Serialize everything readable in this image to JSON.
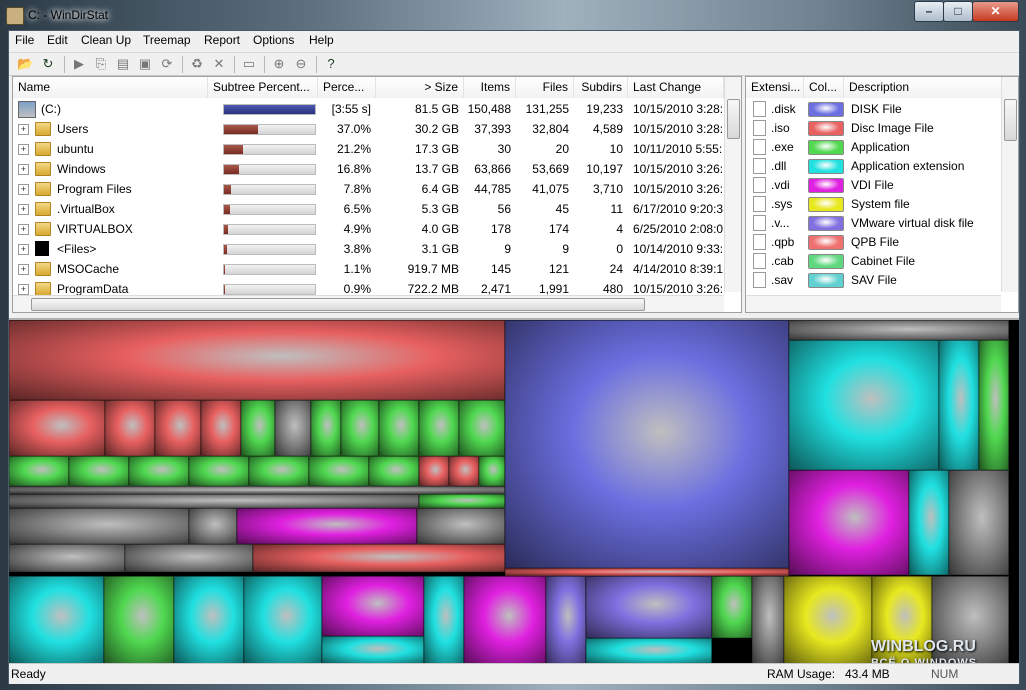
{
  "window": {
    "title": "C: - WinDirStat"
  },
  "menu": [
    "File",
    "Edit",
    "Clean Up",
    "Treemap",
    "Report",
    "Options",
    "Help"
  ],
  "tree": {
    "columns": [
      "Name",
      "Subtree Percent...",
      "Perce...",
      "> Size",
      "Items",
      "Files",
      "Subdirs",
      "Last Change"
    ],
    "rows": [
      {
        "name": "(C:)",
        "bar": 1.0,
        "percent": "[3:55 s]",
        "size": "81.5 GB",
        "items": "150,488",
        "files": "131,255",
        "subdirs": "19,233",
        "last_change": "10/15/2010  3:28:"
      },
      {
        "name": "Users",
        "bar": 0.37,
        "percent": "37.0%",
        "size": "30.2 GB",
        "items": "37,393",
        "files": "32,804",
        "subdirs": "4,589",
        "last_change": "10/15/2010  3:28:"
      },
      {
        "name": "ubuntu",
        "bar": 0.212,
        "percent": "21.2%",
        "size": "17.3 GB",
        "items": "30",
        "files": "20",
        "subdirs": "10",
        "last_change": "10/11/2010  5:55:"
      },
      {
        "name": "Windows",
        "bar": 0.168,
        "percent": "16.8%",
        "size": "13.7 GB",
        "items": "63,866",
        "files": "53,669",
        "subdirs": "10,197",
        "last_change": "10/15/2010  3:26:"
      },
      {
        "name": "Program Files",
        "bar": 0.078,
        "percent": "7.8%",
        "size": "6.4 GB",
        "items": "44,785",
        "files": "41,075",
        "subdirs": "3,710",
        "last_change": "10/15/2010  3:26:"
      },
      {
        "name": ".VirtualBox",
        "bar": 0.065,
        "percent": "6.5%",
        "size": "5.3 GB",
        "items": "56",
        "files": "45",
        "subdirs": "11",
        "last_change": "6/17/2010  9:20:3"
      },
      {
        "name": "VIRTUALBOX",
        "bar": 0.049,
        "percent": "4.9%",
        "size": "4.0 GB",
        "items": "178",
        "files": "174",
        "subdirs": "4",
        "last_change": "6/25/2010  2:08:0"
      },
      {
        "name": "<Files>",
        "bar": 0.038,
        "percent": "3.8%",
        "size": "3.1 GB",
        "items": "9",
        "files": "9",
        "subdirs": "0",
        "last_change": "10/14/2010  9:33:"
      },
      {
        "name": "MSOCache",
        "bar": 0.011,
        "percent": "1.1%",
        "size": "919.7 MB",
        "items": "145",
        "files": "121",
        "subdirs": "24",
        "last_change": "4/14/2010  8:39:1"
      },
      {
        "name": "ProgramData",
        "bar": 0.009,
        "percent": "0.9%",
        "size": "722.2 MB",
        "items": "2,471",
        "files": "1,991",
        "subdirs": "480",
        "last_change": "10/15/2010  3:26:"
      }
    ]
  },
  "extensions": {
    "columns": [
      "Extensi...",
      "Col...",
      "Description"
    ],
    "rows": [
      {
        "ext": ".disk",
        "color": "#6b6fe0",
        "desc": "DISK File"
      },
      {
        "ext": ".iso",
        "color": "#e86060",
        "desc": "Disc Image File"
      },
      {
        "ext": ".exe",
        "color": "#50d850",
        "desc": "Application"
      },
      {
        "ext": ".dll",
        "color": "#20e0e0",
        "desc": "Application extension"
      },
      {
        "ext": ".vdi",
        "color": "#e020e0",
        "desc": "VDI File"
      },
      {
        "ext": ".sys",
        "color": "#e8e820",
        "desc": "System file"
      },
      {
        "ext": ".v...",
        "color": "#8070e0",
        "desc": "VMware virtual disk file"
      },
      {
        "ext": ".qpb",
        "color": "#f07070",
        "desc": "QPB File"
      },
      {
        "ext": ".cab",
        "color": "#60d880",
        "desc": "Cabinet File"
      },
      {
        "ext": ".sav",
        "color": "#60d0d0",
        "desc": "SAV File"
      }
    ]
  },
  "watermark": {
    "line1": "WINBLOG.RU",
    "line2": "ВСЁ О WINDOWS"
  },
  "status": {
    "ready": "Ready",
    "ram_label": "RAM Usage:",
    "ram_value": "43.4 MB",
    "num": "NUM"
  }
}
